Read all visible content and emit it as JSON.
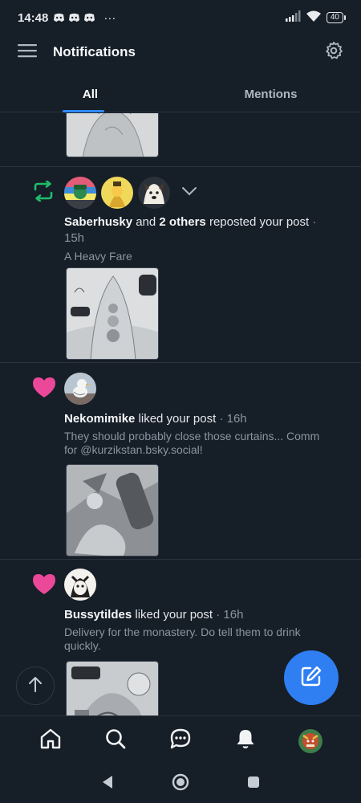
{
  "status_bar": {
    "time": "14:48",
    "dots": "···",
    "battery": "40"
  },
  "header": {
    "title": "Notifications"
  },
  "tabs": [
    {
      "label": "All",
      "active": true
    },
    {
      "label": "Mentions",
      "active": false
    }
  ],
  "notifications": [
    {
      "type": "repost",
      "icon": "repost-icon",
      "user": "Saberhusky",
      "connector": " and ",
      "others": "2 others",
      "action": " reposted your post",
      "time": " · 15h",
      "snippet": "A Heavy Fare"
    },
    {
      "type": "like",
      "icon": "heart-icon",
      "user": "Nekomimike",
      "action": " liked your post",
      "time": " · 16h",
      "snippet": "They should probably close those curtains... Comm for @kurzikstan.bsky.social!"
    },
    {
      "type": "like",
      "icon": "heart-icon",
      "user": "Bussytildes",
      "action": " liked your post",
      "time": " · 16h",
      "snippet": "Delivery for the monastery. Do tell them to drink quickly."
    }
  ],
  "colors": {
    "background": "#161e27",
    "accent": "#2f8af5",
    "repost": "#20bc6b",
    "like": "#ec4899",
    "muted": "#8b95a1"
  },
  "bottom_nav": [
    "home-icon",
    "search-icon",
    "chat-icon",
    "notifications-icon",
    "profile-avatar"
  ]
}
